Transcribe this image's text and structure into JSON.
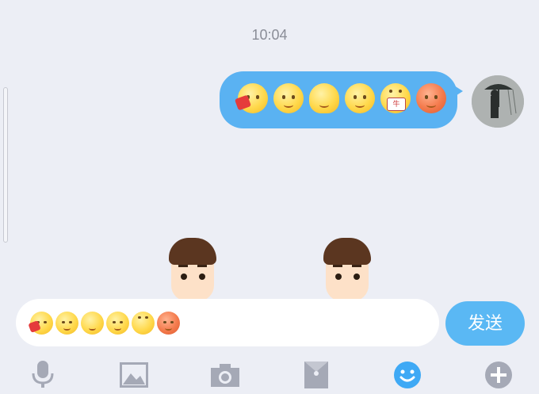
{
  "status": {
    "time": "10:04"
  },
  "message": {
    "emojis": [
      {
        "icon": "hug-red-card-emoji",
        "tone": "yellow"
      },
      {
        "icon": "smirk-emoji",
        "tone": "yellow"
      },
      {
        "icon": "lying-down-emoji",
        "tone": "yellow"
      },
      {
        "icon": "sitting-emoji",
        "tone": "yellow"
      },
      {
        "icon": "niu-sign-emoji",
        "tone": "yellow"
      },
      {
        "icon": "orange-bun-emoji",
        "tone": "orange"
      }
    ]
  },
  "sticker_preview": {
    "sign_text": "牛"
  },
  "composer": {
    "send_label": "发送"
  },
  "toolbar": {
    "items": [
      "microphone-icon",
      "image-icon",
      "camera-icon",
      "red-packet-icon",
      "emoji-icon",
      "plus-icon"
    ],
    "active": "emoji-icon"
  },
  "colors": {
    "accent": "#5ab2f2",
    "icon_gray": "#a5a9b6"
  }
}
